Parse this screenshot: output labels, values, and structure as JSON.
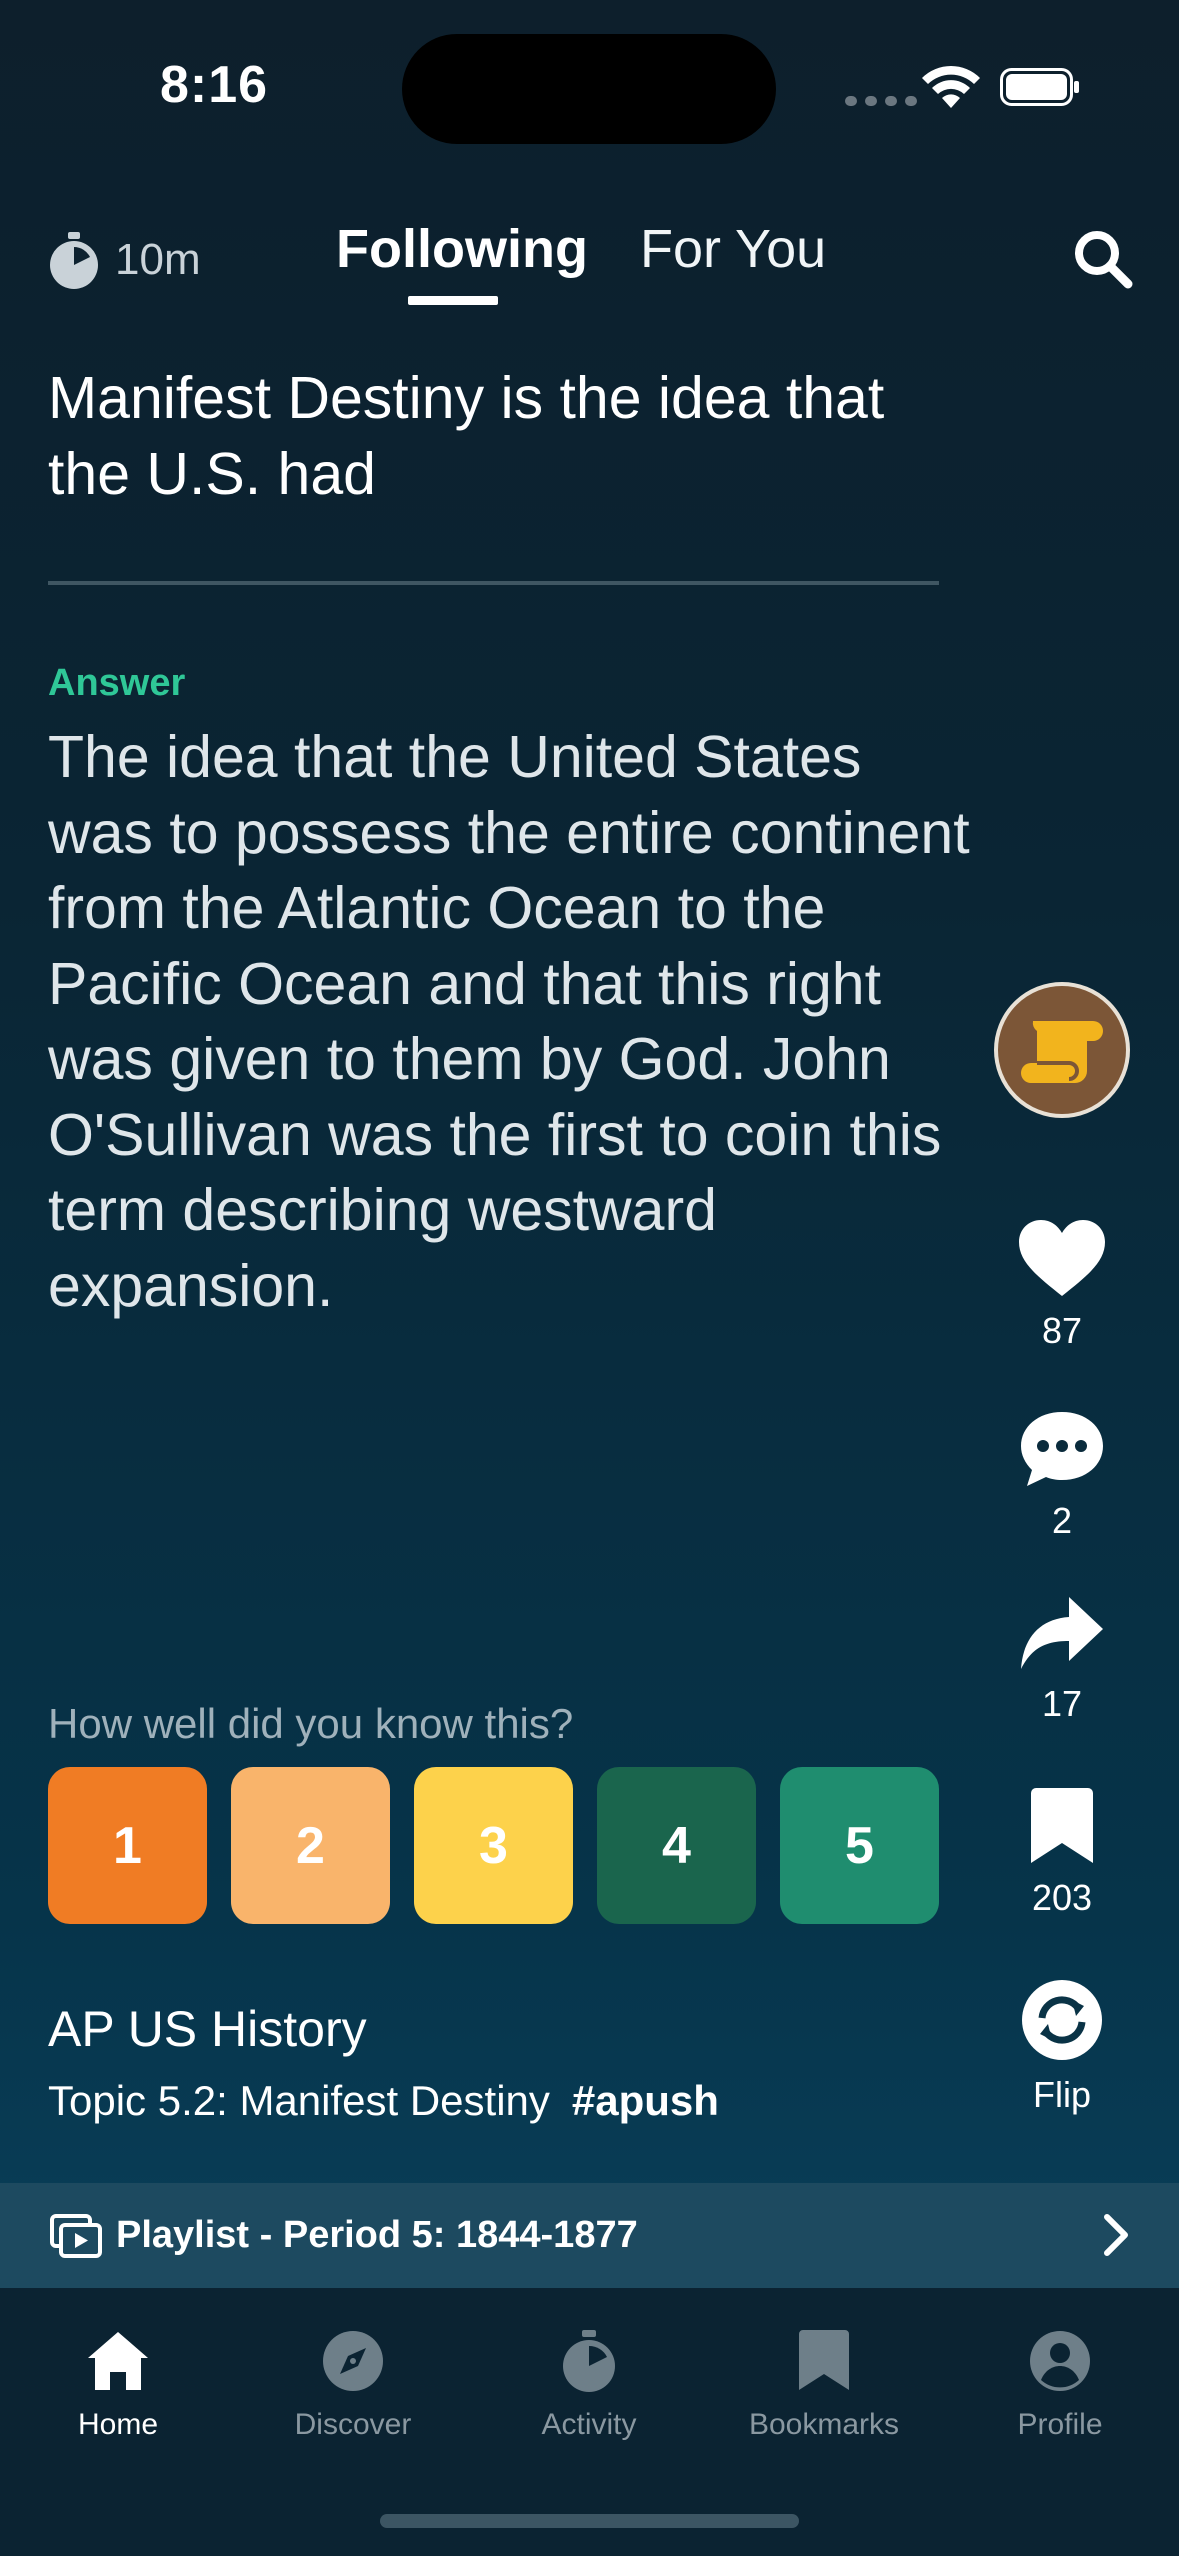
{
  "status_bar": {
    "time": "8:16"
  },
  "header": {
    "timer_label": "10m",
    "tabs": [
      {
        "label": "Following",
        "active": true
      },
      {
        "label": "For You",
        "active": false
      }
    ]
  },
  "card": {
    "question": "Manifest Destiny is the idea that the U.S. had",
    "answer_label": "Answer",
    "answer": "The idea that the United States was to possess the entire continent from the Atlantic Ocean to the Pacific Ocean and that this right was given to them by God. John O'Sullivan was the first to coin this term describing westward expansion."
  },
  "actions": {
    "likes": "87",
    "comments": "2",
    "shares": "17",
    "bookmarks": "203",
    "flip_label": "Flip"
  },
  "rating": {
    "prompt": "How well did you know this?",
    "options": [
      {
        "label": "1",
        "color": "#f07c24"
      },
      {
        "label": "2",
        "color": "#f9b46b"
      },
      {
        "label": "3",
        "color": "#fdd24b"
      },
      {
        "label": "4",
        "color": "#1a654d"
      },
      {
        "label": "5",
        "color": "#1f8d6f"
      }
    ]
  },
  "meta": {
    "course": "AP US History",
    "topic": "Topic 5.2: Manifest Destiny",
    "hashtag": "#apush"
  },
  "playlist": {
    "label": "Playlist - Period 5: 1844-1877"
  },
  "tabbar": {
    "items": [
      {
        "label": "Home",
        "icon": "home-icon",
        "active": true
      },
      {
        "label": "Discover",
        "icon": "compass-icon",
        "active": false
      },
      {
        "label": "Activity",
        "icon": "stopwatch-icon",
        "active": false
      },
      {
        "label": "Bookmarks",
        "icon": "bookmark-icon",
        "active": false
      },
      {
        "label": "Profile",
        "icon": "profile-icon",
        "active": false
      }
    ]
  },
  "colors": {
    "accent_answer": "#2fc797",
    "playlist_bar": "#1d4a60",
    "creator_avatar": "#7c5637",
    "creator_icon": "#f2b41d"
  }
}
